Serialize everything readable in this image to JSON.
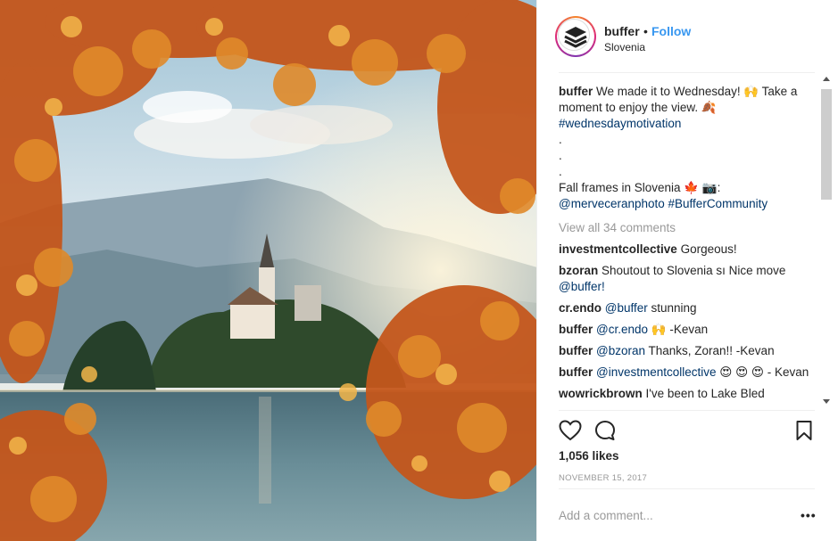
{
  "header": {
    "username": "buffer",
    "separator": "•",
    "follow_label": "Follow",
    "location": "Slovenia"
  },
  "caption": {
    "user": "buffer",
    "text1": "We made it to Wednesday! 🙌 Take a moment to enjoy the view. 🍂",
    "hashtag": "#wednesdaymotivation",
    "dots": [
      ".",
      ".",
      "."
    ],
    "text2": "Fall frames in Slovenia 🍁 📷:",
    "mention": "@merveceranphoto",
    "hashtag2": "#BufferCommunity"
  },
  "view_all_label": "View all 34 comments",
  "comments": [
    {
      "user": "investmentcollective",
      "mention": "",
      "text": "Gorgeous!"
    },
    {
      "user": "bzoran",
      "mention": "",
      "text": "Shoutout to Slovenia sı Nice move ",
      "mention_after": "@buffer!"
    },
    {
      "user": "cr.endo",
      "mention": "@buffer",
      "text": " stunning"
    },
    {
      "user": "buffer",
      "mention": "@cr.endo",
      "text": " 🙌 -Kevan"
    },
    {
      "user": "buffer",
      "mention": "@bzoran",
      "text": " Thanks, Zoran!! -Kevan"
    },
    {
      "user": "buffer",
      "mention": "@investmentcollective",
      "text": " 😍 😍 😍 - Kevan"
    },
    {
      "user": "wowrickbrown",
      "mention": "",
      "text": "I've been to Lake Bled"
    }
  ],
  "likes_label": "1,056 likes",
  "date_label": "NOVEMBER 15, 2017",
  "add_comment_placeholder": "Add a comment...",
  "more_label": "•••",
  "icons": {
    "like": "heart-icon",
    "comment": "comment-icon",
    "save": "bookmark-icon",
    "brand": "buffer-logo-icon"
  },
  "colors": {
    "follow_blue": "#3897f0",
    "link_blue": "#003569",
    "muted_gray": "#999999"
  }
}
